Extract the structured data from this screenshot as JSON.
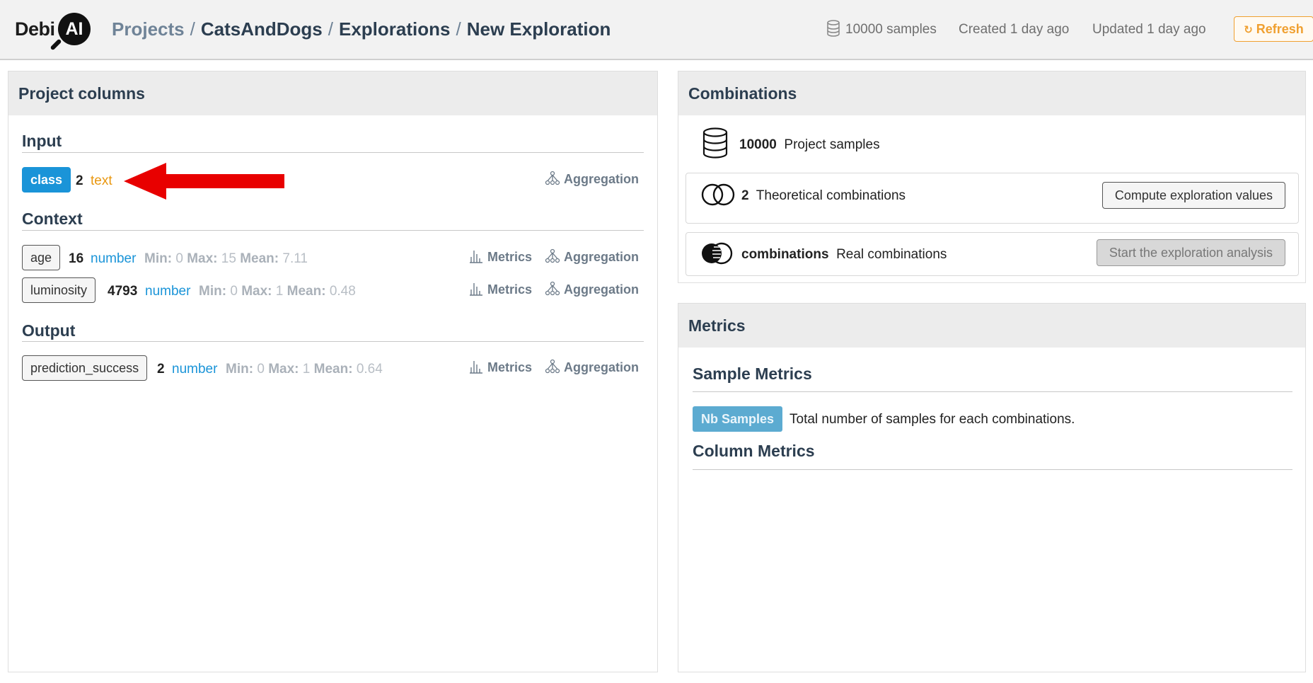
{
  "header": {
    "logo_text": "Debi",
    "logo_badge": "AI",
    "breadcrumb": [
      "Projects",
      "CatsAndDogs",
      "Explorations",
      "New Exploration"
    ],
    "separator": "/",
    "samples": "10000 samples",
    "created": "Created 1 day ago",
    "updated": "Updated 1 day ago",
    "refresh_label": "Refresh"
  },
  "columns_panel": {
    "title": "Project columns",
    "input": {
      "title": "Input",
      "rows": [
        {
          "name": "class",
          "count": "2",
          "type": "text",
          "action": "Aggregation"
        }
      ]
    },
    "context": {
      "title": "Context",
      "rows": [
        {
          "name": "age",
          "count": "16",
          "type": "number",
          "min_label": "Min:",
          "min": "0",
          "max_label": "Max:",
          "max": "15",
          "mean_label": "Mean:",
          "mean": "7.11",
          "metrics": "Metrics",
          "aggregation": "Aggregation"
        },
        {
          "name": "luminosity",
          "count": "4793",
          "type": "number",
          "min_label": "Min:",
          "min": "0",
          "max_label": "Max:",
          "max": "1",
          "mean_label": "Mean:",
          "mean": "0.48",
          "metrics": "Metrics",
          "aggregation": "Aggregation"
        }
      ]
    },
    "output": {
      "title": "Output",
      "rows": [
        {
          "name": "prediction_success",
          "count": "2",
          "type": "number",
          "min_label": "Min:",
          "min": "0",
          "max_label": "Max:",
          "max": "1",
          "mean_label": "Mean:",
          "mean": "0.64",
          "metrics": "Metrics",
          "aggregation": "Aggregation"
        }
      ]
    }
  },
  "combinations_panel": {
    "title": "Combinations",
    "project_samples": {
      "value": "10000",
      "label": "Project samples"
    },
    "theoretical": {
      "value": "2",
      "label": "Theoretical combinations",
      "button": "Compute exploration values"
    },
    "real": {
      "value": "combinations",
      "label": "Real combinations",
      "button": "Start the exploration analysis"
    }
  },
  "metrics_panel": {
    "title": "Metrics",
    "sample_metrics_title": "Sample Metrics",
    "nb_samples_badge": "Nb Samples",
    "nb_samples_desc": "Total number of samples for each combinations.",
    "column_metrics_title": "Column Metrics"
  },
  "colors": {
    "accent_blue": "#1a94d8",
    "accent_orange": "#f0a030",
    "arrow_red": "#e80000"
  }
}
